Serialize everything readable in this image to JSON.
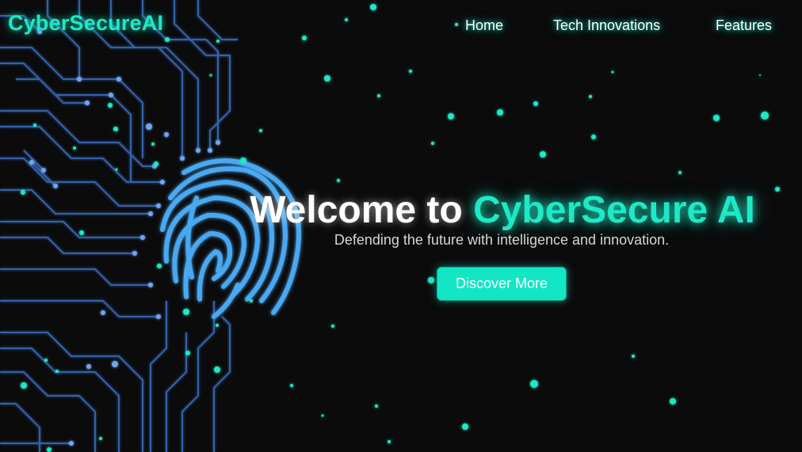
{
  "nav": {
    "logo": "CyberSecureAI",
    "links": [
      "Home",
      "Tech Innovations",
      "Features"
    ]
  },
  "hero": {
    "title_prefix": "Welcome to ",
    "title_accent": "CyberSecure AI",
    "subtitle": "Defending the future with intelligence and innovation.",
    "cta_label": "Discover More"
  },
  "colors": {
    "background": "#0b0b0c",
    "accent": "#1de9c6",
    "button": "#12e6c5",
    "circuit": "#3f7fd9",
    "fingerprint": "#4aa8f0"
  }
}
